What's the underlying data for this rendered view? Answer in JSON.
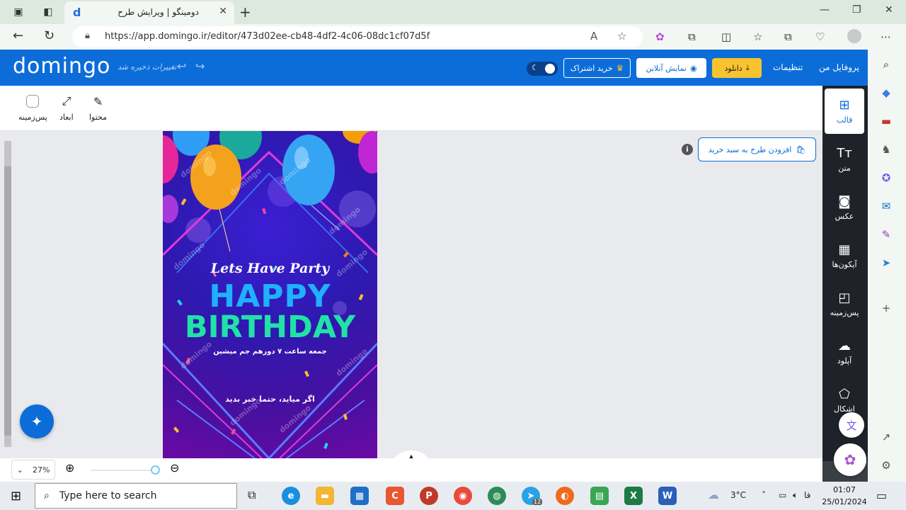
{
  "browser": {
    "tab_title": "دومینگو | ویرایش طرح",
    "tab_favicon": "d",
    "url": "https://app.domingo.ir/editor/473d02ee-cb48-4df2-4c06-08dc1cf07d5f"
  },
  "header": {
    "logo": "domingo",
    "saved_status": "تغییرات ذخیره شد",
    "subscribe_label": "خرید اشتراک",
    "preview_label": "نمایش آنلاین",
    "download_label": "دانلود",
    "settings_label": "تنظیمات",
    "profile_label": "پروفایل من"
  },
  "nav": {
    "items": [
      {
        "label": "قالب",
        "icon": "template-icon"
      },
      {
        "label": "متن",
        "icon": "text-icon"
      },
      {
        "label": "عکس",
        "icon": "image-icon"
      },
      {
        "label": "آیکون‌ها",
        "icon": "icons-grid-icon"
      },
      {
        "label": "پس‌زمینه",
        "icon": "background-icon"
      },
      {
        "label": "آپلود",
        "icon": "upload-cloud-icon"
      },
      {
        "label": "اشکال",
        "icon": "shapes-icon"
      }
    ]
  },
  "toolbar": {
    "content_label": "محتوا",
    "dimensions_label": "ابعاد",
    "background_label": "پس‌زمینه"
  },
  "workspace": {
    "add_to_cart_label": "افزودن طرح به سبد خرید"
  },
  "design": {
    "line1": "Lets Have Party",
    "line2": "HAPPY",
    "line3": "BIRTHDAY",
    "line4": "جمعه ساعت ۷ دورهم جم میشین",
    "line5": "اگر میاید، حتما خبر بدید",
    "watermark": "domingo"
  },
  "zoom": {
    "value": "27%"
  },
  "taskbar": {
    "search_placeholder": "Type here to search",
    "weather": "3°C",
    "lang": "فا",
    "time": "01:07",
    "date": "25/01/2024",
    "telegram_badge": "12"
  },
  "colors": {
    "brand_blue": "#0c6dd9",
    "download_yellow": "#f7c32f",
    "nav_dark": "#1f2329"
  }
}
